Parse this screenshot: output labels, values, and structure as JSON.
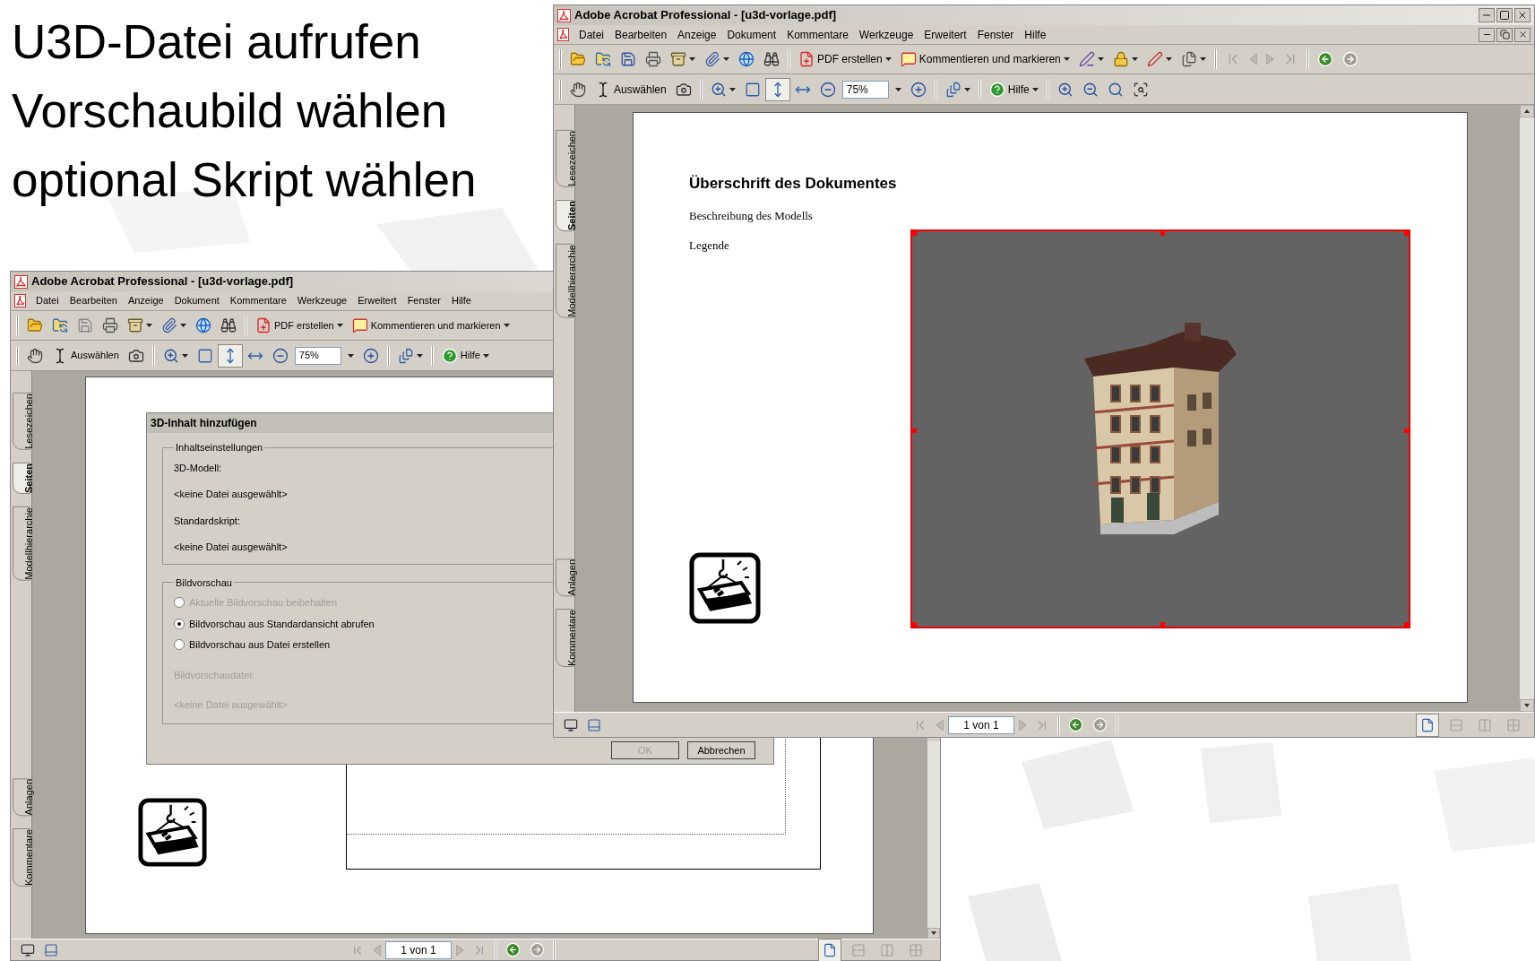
{
  "slide": {
    "lines": [
      "U3D-Datei aufrufen",
      "Vorschaubild wählen",
      "optional Skript wählen"
    ]
  },
  "back_window": {
    "title": "Adobe Acrobat Professional - [u3d-vorlage.pdf]",
    "menu": [
      "Datei",
      "Bearbeiten",
      "Anzeige",
      "Dokument",
      "Kommentare",
      "Werkzeuge",
      "Erweitert",
      "Fenster",
      "Hilfe"
    ],
    "create_pdf": "PDF erstellen",
    "comment": "Kommentieren und markieren",
    "select_tool": "Auswählen",
    "zoom": "75%",
    "help": "Hilfe",
    "fit_modes": [
      {
        "kind": "full-page",
        "selected": false
      },
      {
        "kind": "fit-height",
        "selected": true
      },
      {
        "kind": "fit-width",
        "selected": false
      }
    ],
    "side_tabs_top": [
      {
        "label": "Lesezeichen",
        "selected": false
      },
      {
        "label": "Seiten",
        "selected": true
      },
      {
        "label": "Modellhierarchie",
        "selected": false
      }
    ],
    "side_tabs_bottom": [
      {
        "label": "Anlagen",
        "selected": false
      },
      {
        "label": "Kommentare",
        "selected": false
      }
    ],
    "page_indicator": "1 von 1",
    "layout_modes": [
      {
        "kind": "single",
        "selected": true
      },
      {
        "kind": "continuous",
        "selected": false
      },
      {
        "kind": "facing",
        "selected": false
      },
      {
        "kind": "continuous-facing",
        "selected": false
      }
    ],
    "dialog": {
      "title": "3D-Inhalt hinzufügen",
      "content_group": {
        "legend": "Inhaltseinstellungen",
        "model_label": "3D-Modell:",
        "model_file": "<keine Datei ausgewählt>",
        "script_label": "Standardskript:",
        "script_file": "<keine Datei ausgewählt>"
      },
      "preview_group": {
        "legend": "Bildvorschau",
        "options": [
          {
            "label": "Aktuelle Bildvorschau beibehalten",
            "selected": false,
            "disabled": true
          },
          {
            "label": "Bildvorschau aus Standardansicht abrufen",
            "selected": true,
            "disabled": false
          },
          {
            "label": "Bildvorschau aus Datei erstellen",
            "selected": false,
            "disabled": false
          }
        ],
        "file_label": {
          "text": "Bildvorschaudatei:",
          "disabled": true
        },
        "file": {
          "text": "<keine Datei ausgewählt>",
          "disabled": true
        }
      },
      "buttons": [
        {
          "label": "OK",
          "disabled": true
        },
        {
          "label": "Abbrechen",
          "disabled": false
        }
      ]
    }
  },
  "front_window": {
    "title": "Adobe Acrobat Professional - [u3d-vorlage.pdf]",
    "menu": [
      "Datei",
      "Bearbeiten",
      "Anzeige",
      "Dokument",
      "Kommentare",
      "Werkzeuge",
      "Erweitert",
      "Fenster",
      "Hilfe"
    ],
    "create_pdf": "PDF erstellen",
    "comment": "Kommentieren und markieren",
    "select_tool": "Auswählen",
    "zoom": "75%",
    "help": "Hilfe",
    "fit_modes": [
      {
        "kind": "full-page",
        "selected": false
      },
      {
        "kind": "fit-height",
        "selected": true
      },
      {
        "kind": "fit-width",
        "selected": false
      }
    ],
    "side_tabs_top": [
      {
        "label": "Lesezeichen",
        "selected": false
      },
      {
        "label": "Seiten",
        "selected": true
      },
      {
        "label": "Modellhierarchie",
        "selected": false
      }
    ],
    "side_tabs_bottom": [
      {
        "label": "Anlagen",
        "selected": false
      },
      {
        "label": "Kommentare",
        "selected": false
      }
    ],
    "page": {
      "heading": "Überschrift des Dokumentes",
      "lines": [
        "Beschreibung des Modells",
        "Legende"
      ]
    },
    "page_indicator": "1 von 1",
    "layout_modes": [
      {
        "kind": "single",
        "selected": true
      },
      {
        "kind": "continuous",
        "selected": false
      },
      {
        "kind": "facing",
        "selected": false
      },
      {
        "kind": "continuous-facing",
        "selected": false
      }
    ]
  }
}
